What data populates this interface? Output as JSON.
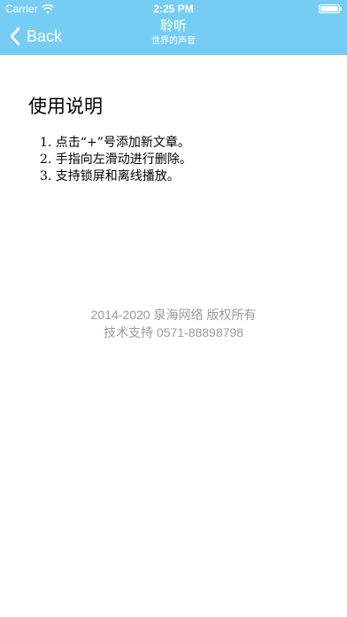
{
  "status_bar": {
    "carrier": "Carrier",
    "time": "2:25 PM",
    "battery_level": 1.0,
    "wifi_icon": "wifi-icon",
    "battery_icon": "battery-icon"
  },
  "nav": {
    "back_label": "Back",
    "back_icon": "chevron-left-icon",
    "title": "聆听",
    "subtitle": "世界的声音"
  },
  "content": {
    "heading": "使用说明",
    "items": [
      "1. 点击“+”号添加新文章。",
      "2. 手指向左滑动进行删除。",
      "3. 支持锁屏和离线播放。"
    ]
  },
  "footer": {
    "copyright": "2014-2020 泉海网络 版权所有",
    "support": "技术支持 0571-88898798"
  },
  "colors": {
    "accent": "#76cdf4",
    "footer_text": "#9b9b9b",
    "bar_text": "#ffffff"
  }
}
